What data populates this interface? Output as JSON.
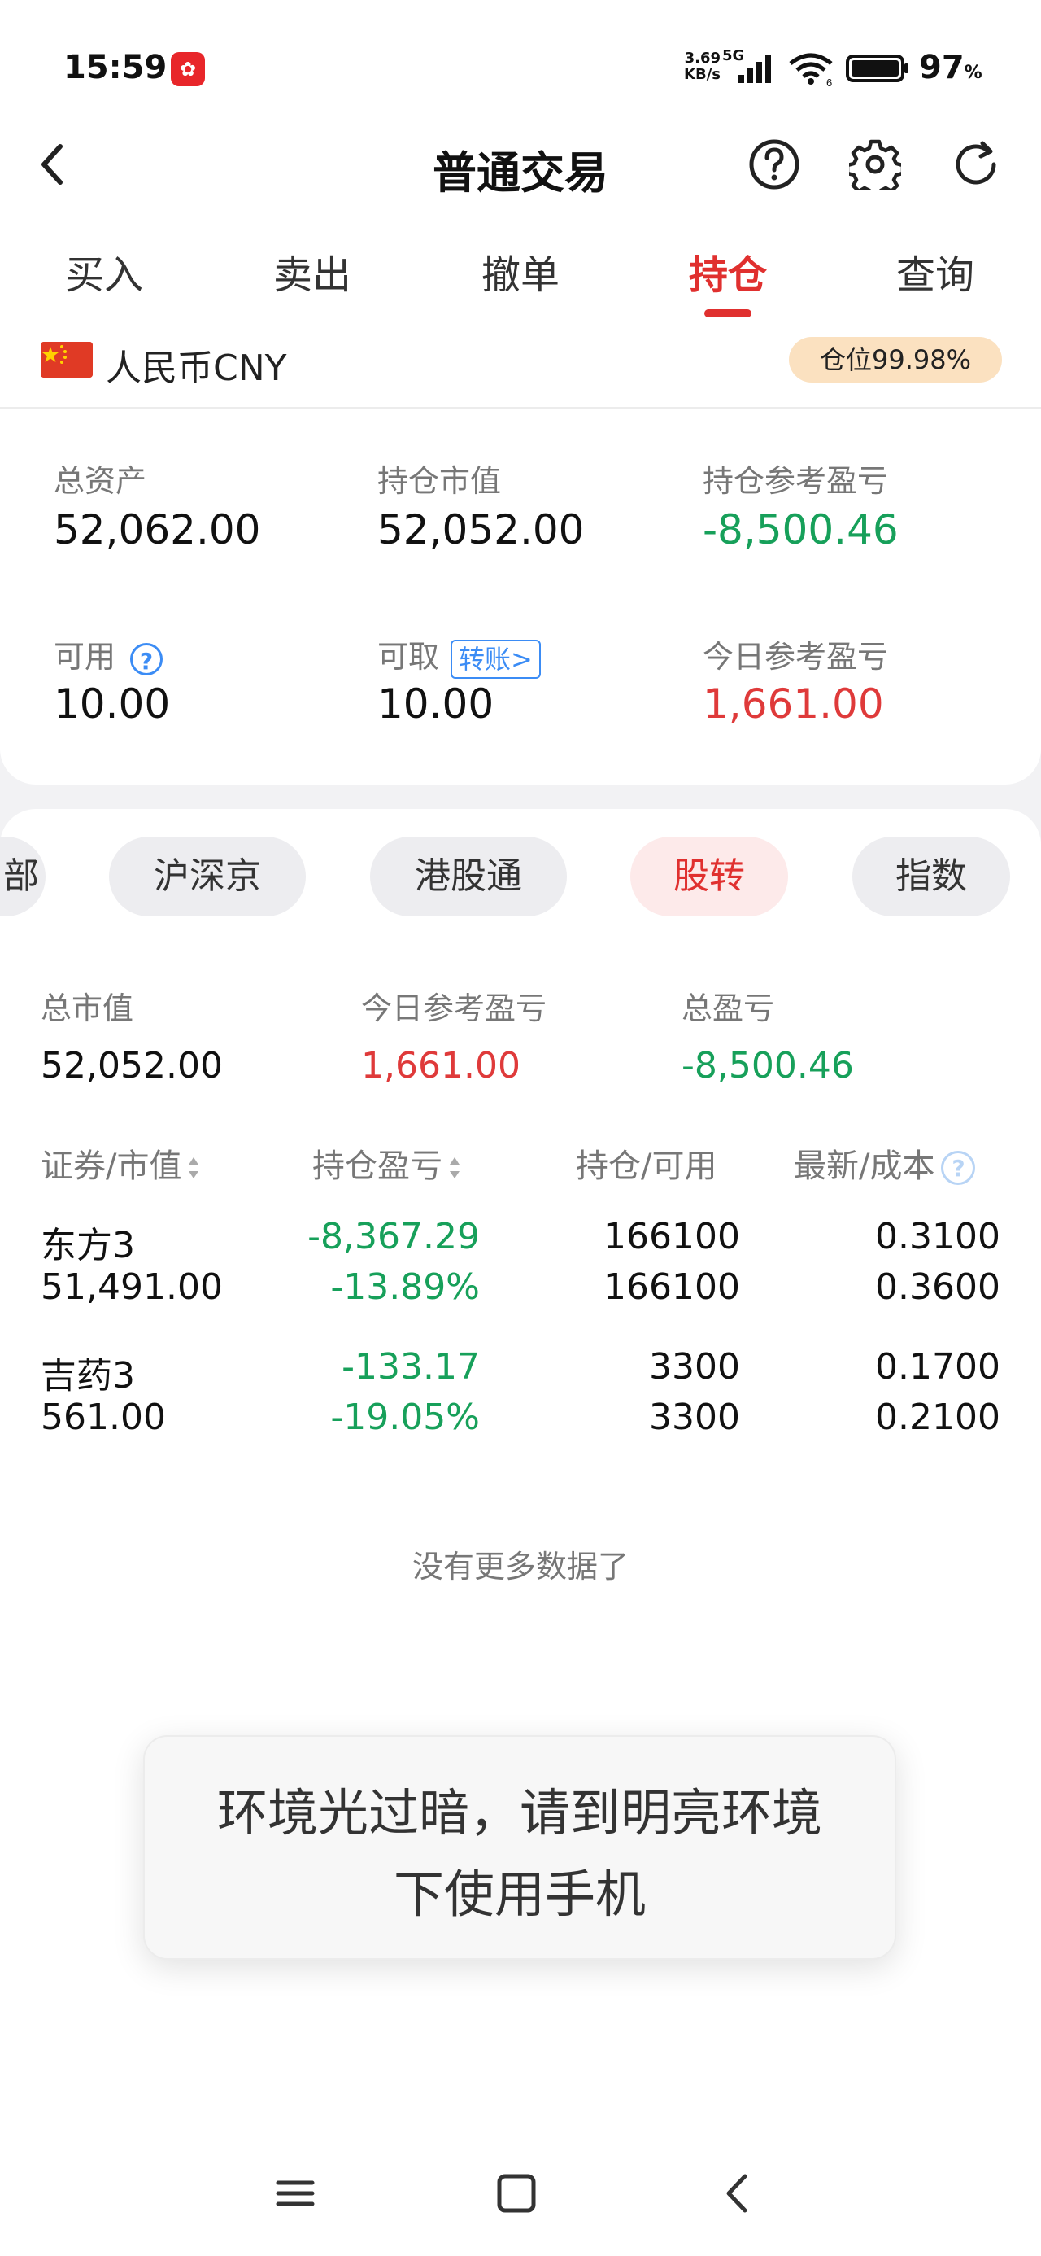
{
  "status": {
    "time": "15:59",
    "speed_top": "3.69",
    "speed_bottom": "KB/s",
    "network": "5G",
    "wifi_sub": "6",
    "battery_pct": "97",
    "pct_sign": "%"
  },
  "header": {
    "title": "普通交易",
    "icons": [
      "back-icon",
      "help-circle-icon",
      "gear-icon",
      "refresh-icon"
    ]
  },
  "tabs": [
    {
      "label": "买入"
    },
    {
      "label": "卖出"
    },
    {
      "label": "撤单"
    },
    {
      "label": "持仓",
      "active": true
    },
    {
      "label": "查询"
    }
  ],
  "account": {
    "currency": "人民币CNY",
    "position_badge": "仓位99.98%"
  },
  "assets": {
    "total_label": "总资产",
    "total_value": "52,062.00",
    "market_label": "持仓市值",
    "market_value": "52,052.00",
    "pnl_label": "持仓参考盈亏",
    "pnl_value": "-8,500.46",
    "avail_label": "可用",
    "avail_value": "10.00",
    "withdraw_label": "可取",
    "transfer_label": "转账>",
    "withdraw_value": "10.00",
    "today_label": "今日参考盈亏",
    "today_value": "1,661.00"
  },
  "market_chips": [
    {
      "label": "部"
    },
    {
      "label": "沪深京"
    },
    {
      "label": "港股通"
    },
    {
      "label": "股转",
      "active": true
    },
    {
      "label": "指数"
    }
  ],
  "summary": {
    "mv_label": "总市值",
    "mv_value": "52,052.00",
    "today_label": "今日参考盈亏",
    "today_value": "1,661.00",
    "total_label": "总盈亏",
    "total_value": "-8,500.46"
  },
  "columns": [
    "证券/市值",
    "持仓盈亏",
    "持仓/可用",
    "最新/成本"
  ],
  "holdings": [
    {
      "name": "东方3",
      "market_value": "51,491.00",
      "pnl": "-8,367.29",
      "pnl_pct": "-13.89%",
      "position": "166100",
      "available": "166100",
      "latest": "0.3100",
      "cost": "0.3600"
    },
    {
      "name": "吉药3",
      "market_value": "561.00",
      "pnl": "-133.17",
      "pnl_pct": "-19.05%",
      "position": "3300",
      "available": "3300",
      "latest": "0.1700",
      "cost": "0.2100"
    }
  ],
  "no_more": "没有更多数据了",
  "toast": "环境光过暗，请到明亮环境下使用手机",
  "colors": {
    "accent_red": "#e0302f",
    "gain_red": "#df3a3a",
    "loss_green": "#17a05a",
    "badge_bg": "#fbe1c0",
    "link_blue": "#3b8cf5"
  }
}
